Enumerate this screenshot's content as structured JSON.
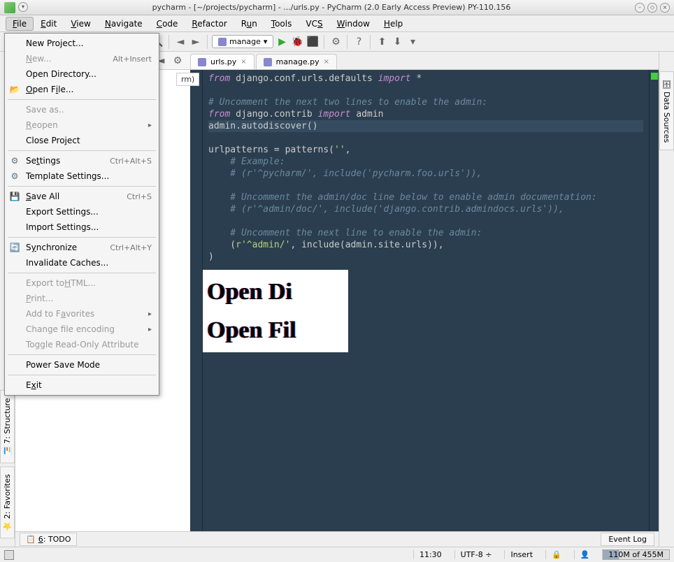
{
  "titlebar": {
    "title": "pycharm - [~/projects/pycharm] - .../urls.py - PyCharm (2.0 Early Access Preview) PY-110.156"
  },
  "menubar": {
    "file": "File",
    "edit": "Edit",
    "view": "View",
    "navigate": "Navigate",
    "code": "Code",
    "refactor": "Refactor",
    "run": "Run",
    "tools": "Tools",
    "vcs": "VCS",
    "window": "Window",
    "help": "Help"
  },
  "run_config": {
    "label": "manage"
  },
  "file_menu": {
    "new_project": "New Project...",
    "new": "New...",
    "new_shortcut": "Alt+Insert",
    "open_directory": "Open Directory...",
    "open_file": "Open File...",
    "save_as": "Save as..",
    "reopen": "Reopen",
    "close_project": "Close Project",
    "settings": "Settings",
    "settings_shortcut": "Ctrl+Alt+S",
    "template_settings": "Template Settings...",
    "save_all": "Save All",
    "save_all_shortcut": "Ctrl+S",
    "export_settings": "Export Settings...",
    "import_settings": "Import Settings...",
    "synchronize": "Synchronize",
    "synchronize_shortcut": "Ctrl+Alt+Y",
    "invalidate_caches": "Invalidate Caches...",
    "export_html": "Export to HTML...",
    "print": "Print...",
    "add_to_favorites": "Add to Favorites",
    "change_file_encoding": "Change file encoding",
    "toggle_readonly": "Toggle Read-Only Attribute",
    "power_save": "Power Save Mode",
    "exit": "Exit"
  },
  "tabs": {
    "urls": "urls.py",
    "manage": "manage.py"
  },
  "breadcrumb_hidden": "rm)",
  "code": {
    "l1_from": "from",
    "l1_mod": " django.conf.urls.defaults ",
    "l1_import": "import",
    "l1_star": " *",
    "l2": "",
    "l3": "# Uncomment the next two lines to enable the admin:",
    "l4_from": "from",
    "l4_mod": " django.contrib ",
    "l4_import": "import",
    "l4_admin": " admin",
    "l5": "admin.autodiscover()",
    "l6": "",
    "l7a": "urlpatterns = patterns(",
    "l7b": "''",
    "l7c": ",",
    "l8": "    # Example:",
    "l9": "    # (r'^pycharm/', include('pycharm.foo.urls')),",
    "l10": "",
    "l11": "    # Uncomment the admin/doc line below to enable admin documentation:",
    "l12": "    # (r'^admin/doc/', include('django.contrib.admindocs.urls')),",
    "l13": "",
    "l14": "    # Uncomment the next line to enable the admin:",
    "l15a": "    (",
    "l15b": "r'^admin/'",
    "l15c": ", include(admin.site.urls)),",
    "l16": ")"
  },
  "overlay": {
    "line1": "Open Di",
    "line2": "Open Fil"
  },
  "side_tabs": {
    "structure": "7: Structure",
    "favorites": "2: Favorites",
    "data_sources": "Data Sources"
  },
  "bottom": {
    "todo": "6: TODO",
    "event_log": "Event Log"
  },
  "status": {
    "pos": "11:30",
    "encoding": "UTF-8",
    "insert": "Insert",
    "mem": "110M of 455M"
  }
}
